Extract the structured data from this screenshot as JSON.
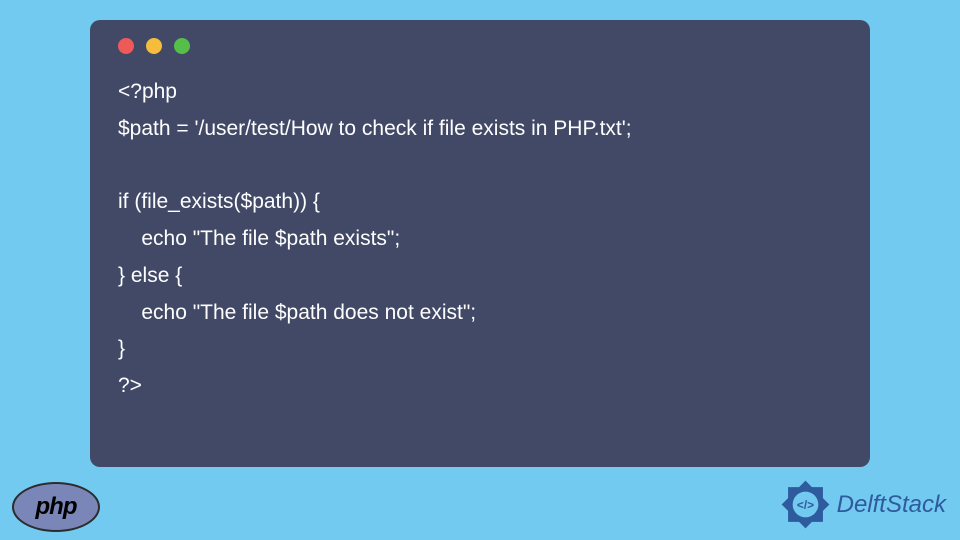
{
  "code": {
    "line1": "<?php",
    "line2": "$path = '/user/test/How to check if file exists in PHP.txt';",
    "line3": "",
    "line4": "if (file_exists($path)) {",
    "line5": "    echo \"The file $path exists\";",
    "line6": "} else {",
    "line7": "    echo \"The file $path does not exist\";",
    "line8": "}",
    "line9": "?>"
  },
  "logos": {
    "php": "php",
    "delft": "DelftStack"
  }
}
